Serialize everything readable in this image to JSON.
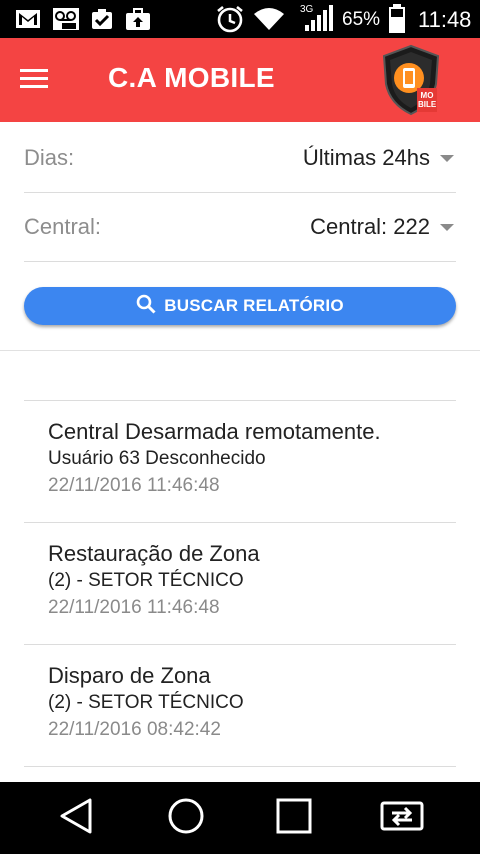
{
  "status_bar": {
    "battery_percent": "65%",
    "time": "11:48",
    "network_type": "3G",
    "icons": [
      "gmail-icon",
      "voicemail-icon",
      "clipboard-check-icon",
      "briefcase-upload-icon",
      "alarm-icon",
      "wifi-icon",
      "signal-icon",
      "battery-icon"
    ]
  },
  "app_bar": {
    "title": "C.A MOBILE",
    "menu_icon": "hamburger-menu-icon",
    "logo_icon": "shield-phone-logo",
    "logo_text": "MO BILE"
  },
  "filters": {
    "dias": {
      "label": "Dias:",
      "value": "Últimas 24hs"
    },
    "central": {
      "label": "Central:",
      "value": "Central: 222"
    }
  },
  "search_button": {
    "label": "BUSCAR RELATÓRIO",
    "icon": "search-icon"
  },
  "reports": [
    {
      "title": "Central Desarmada remotamente.",
      "subtitle": "Usuário 63 Desconhecido",
      "datetime": "22/11/2016 11:46:48"
    },
    {
      "title": "Restauração de Zona",
      "subtitle": "(2) - SETOR TÉCNICO",
      "datetime": "22/11/2016 11:46:48"
    },
    {
      "title": "Disparo de Zona",
      "subtitle": "(2) - SETOR TÉCNICO",
      "datetime": "22/11/2016 08:42:42"
    }
  ],
  "nav_bar": {
    "icons": [
      "back-icon",
      "home-icon",
      "recents-icon",
      "screen-cast-icon"
    ]
  },
  "colors": {
    "app_bar": "#f44443",
    "button": "#3c86f0",
    "status_bar": "#000000"
  }
}
